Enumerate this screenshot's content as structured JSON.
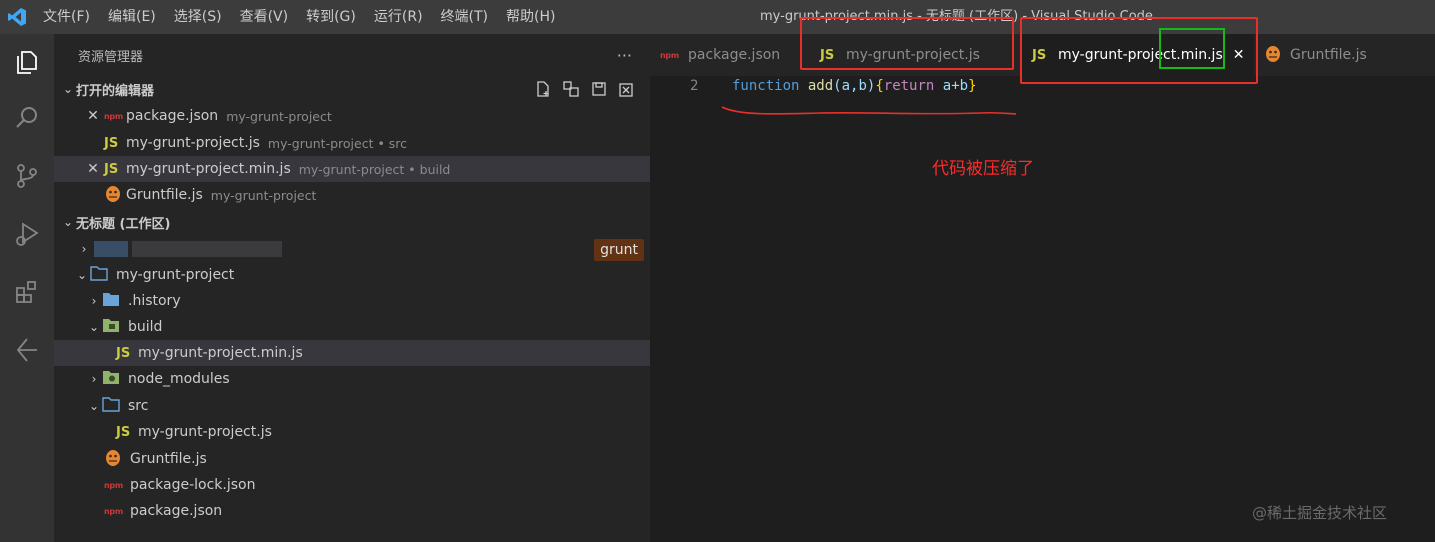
{
  "titlebar": {
    "menu": [
      "文件(F)",
      "编辑(E)",
      "选择(S)",
      "查看(V)",
      "转到(G)",
      "运行(R)",
      "终端(T)",
      "帮助(H)"
    ],
    "title": "my-grunt-project.min.js - 无标题 (工作区) - Visual Studio Code"
  },
  "sidebar": {
    "title": "资源管理器",
    "more": "···",
    "open_editors": {
      "label": "打开的编辑器",
      "items": [
        {
          "name": "package.json",
          "desc": "my-grunt-project",
          "icon": "npm-icon"
        },
        {
          "name": "my-grunt-project.js",
          "desc": "my-grunt-project • src",
          "icon": "js-icon"
        },
        {
          "name": "my-grunt-project.min.js",
          "desc": "my-grunt-project • build",
          "icon": "js-icon"
        },
        {
          "name": "Gruntfile.js",
          "desc": "my-grunt-project",
          "icon": "grunt-icon"
        }
      ]
    },
    "workspace": {
      "label": "无标题 (工作区)",
      "badge": "grunt",
      "tree": [
        {
          "name": "my-grunt-project",
          "icon": "folder-root-icon"
        },
        {
          "name": ".history",
          "icon": "folder-icon"
        },
        {
          "name": "build",
          "icon": "folder-build-icon"
        },
        {
          "name": "my-grunt-project.min.js",
          "icon": "js-icon"
        },
        {
          "name": "node_modules",
          "icon": "folder-node-icon"
        },
        {
          "name": "src",
          "icon": "folder-src-icon"
        },
        {
          "name": "my-grunt-project.js",
          "icon": "js-icon"
        },
        {
          "name": "Gruntfile.js",
          "icon": "grunt-icon"
        },
        {
          "name": "package-lock.json",
          "icon": "npm-icon"
        },
        {
          "name": "package.json",
          "icon": "npm-icon"
        }
      ]
    }
  },
  "tabs": [
    {
      "label": "package.json",
      "icon": "npm-icon"
    },
    {
      "label": "my-grunt-project.js",
      "icon": "js-icon"
    },
    {
      "label": "my-grunt-project.min.js",
      "icon": "js-icon",
      "active": true
    },
    {
      "label": "Gruntfile.js",
      "icon": "grunt-icon"
    }
  ],
  "editor": {
    "line_number": "2",
    "code": {
      "kw": "function",
      "fn": "add",
      "params": "(a,b)",
      "open": "{",
      "ret": "return",
      "expr": " a+b",
      "close": "}"
    },
    "annotation": "代码被压缩了"
  },
  "watermark": "@稀土掘金技术社区",
  "colors": {
    "annotation_red": "#e8302a",
    "highlight_green": "#18b818",
    "search_highlight": "#613214"
  }
}
